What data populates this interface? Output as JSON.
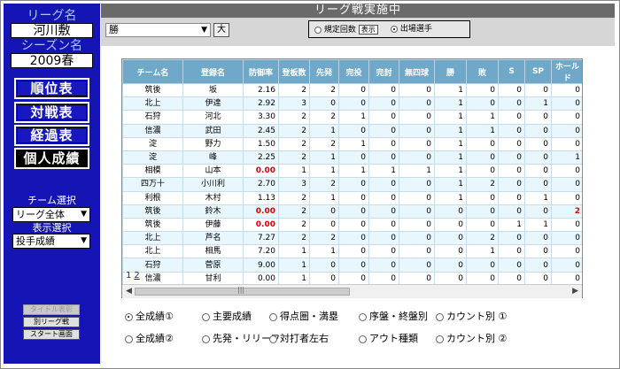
{
  "sidebar": {
    "league_label": "リーグ名",
    "league_value": "河川敷",
    "season_label": "シーズン名",
    "season_value": "2009春",
    "nav": [
      "順位表",
      "対戦表",
      "経過表",
      "個人成績"
    ],
    "team_select_label": "チーム選択",
    "team_select_value": "リーグ全体",
    "display_select_label": "表示選択",
    "display_select_value": "投手成績",
    "buttons": [
      "タイトル表彰",
      "別リーグ戦",
      "スタート画面"
    ]
  },
  "header": {
    "title": "リーグ戦実施中"
  },
  "toolbar": {
    "sort_value": "勝",
    "large_button": "大",
    "opt_regulation": "規定回数",
    "show_button": "表示",
    "opt_played": "出場選手"
  },
  "table": {
    "columns": [
      "チーム名",
      "登録名",
      "防御率",
      "登板数",
      "先発",
      "完投",
      "完封",
      "無四球",
      "勝",
      "敗",
      "S",
      "SP",
      "ホールド"
    ],
    "rows": [
      [
        "筑後",
        "坂",
        "2.16",
        "2",
        "2",
        "0",
        "0",
        "0",
        "1",
        "0",
        "0",
        "0",
        "0"
      ],
      [
        "北上",
        "伊達",
        "2.92",
        "3",
        "0",
        "0",
        "0",
        "0",
        "1",
        "0",
        "0",
        "1",
        "0"
      ],
      [
        "石狩",
        "河北",
        "3.30",
        "2",
        "2",
        "1",
        "0",
        "0",
        "1",
        "1",
        "0",
        "0",
        "0"
      ],
      [
        "信濃",
        "武田",
        "2.45",
        "2",
        "1",
        "0",
        "0",
        "0",
        "1",
        "1",
        "0",
        "0",
        "0"
      ],
      [
        "淀",
        "野力",
        "1.50",
        "2",
        "2",
        "1",
        "0",
        "0",
        "1",
        "0",
        "0",
        "0",
        "0"
      ],
      [
        "淀",
        "峰",
        "2.25",
        "2",
        "1",
        "0",
        "0",
        "0",
        "1",
        "0",
        "0",
        "0",
        "1"
      ],
      [
        "相模",
        "山本",
        "0.00",
        "1",
        "1",
        "1",
        "1",
        "1",
        "1",
        "0",
        "0",
        "0",
        "0"
      ],
      [
        "四万十",
        "小川利",
        "2.70",
        "3",
        "2",
        "0",
        "0",
        "0",
        "1",
        "2",
        "0",
        "0",
        "0"
      ],
      [
        "利根",
        "木村",
        "1.13",
        "2",
        "1",
        "0",
        "0",
        "0",
        "1",
        "0",
        "0",
        "1",
        "0"
      ],
      [
        "筑後",
        "鈴木",
        "0.00",
        "2",
        "0",
        "0",
        "0",
        "0",
        "0",
        "0",
        "0",
        "0",
        "2"
      ],
      [
        "筑後",
        "伊藤",
        "0.00",
        "2",
        "0",
        "0",
        "0",
        "0",
        "0",
        "0",
        "1",
        "1",
        "0"
      ],
      [
        "北上",
        "芦名",
        "7.27",
        "2",
        "2",
        "0",
        "0",
        "0",
        "0",
        "2",
        "0",
        "0",
        "0"
      ],
      [
        "北上",
        "相馬",
        "7.20",
        "1",
        "1",
        "0",
        "0",
        "0",
        "0",
        "1",
        "0",
        "0",
        "0"
      ],
      [
        "石狩",
        "菅原",
        "9.00",
        "1",
        "0",
        "0",
        "0",
        "0",
        "0",
        "0",
        "0",
        "0",
        "0"
      ],
      [
        "信濃",
        "甘利",
        "0.00",
        "1",
        "0",
        "0",
        "0",
        "0",
        "0",
        "0",
        "0",
        "0",
        "0"
      ]
    ],
    "red_cells": [
      [
        6,
        2
      ],
      [
        9,
        2
      ],
      [
        10,
        2
      ],
      [
        9,
        12
      ]
    ]
  },
  "pages": [
    "1",
    "2"
  ],
  "stat_options": {
    "row1": [
      "全成績①",
      "主要成績",
      "得点圏・満塁",
      "序盤・終盤別",
      "カウント別 ①"
    ],
    "row2": [
      "全成績②",
      "先発・リリーフ",
      "対打者左右",
      "アウト種類",
      "カウント別 ②"
    ],
    "selected": "全成績①"
  }
}
